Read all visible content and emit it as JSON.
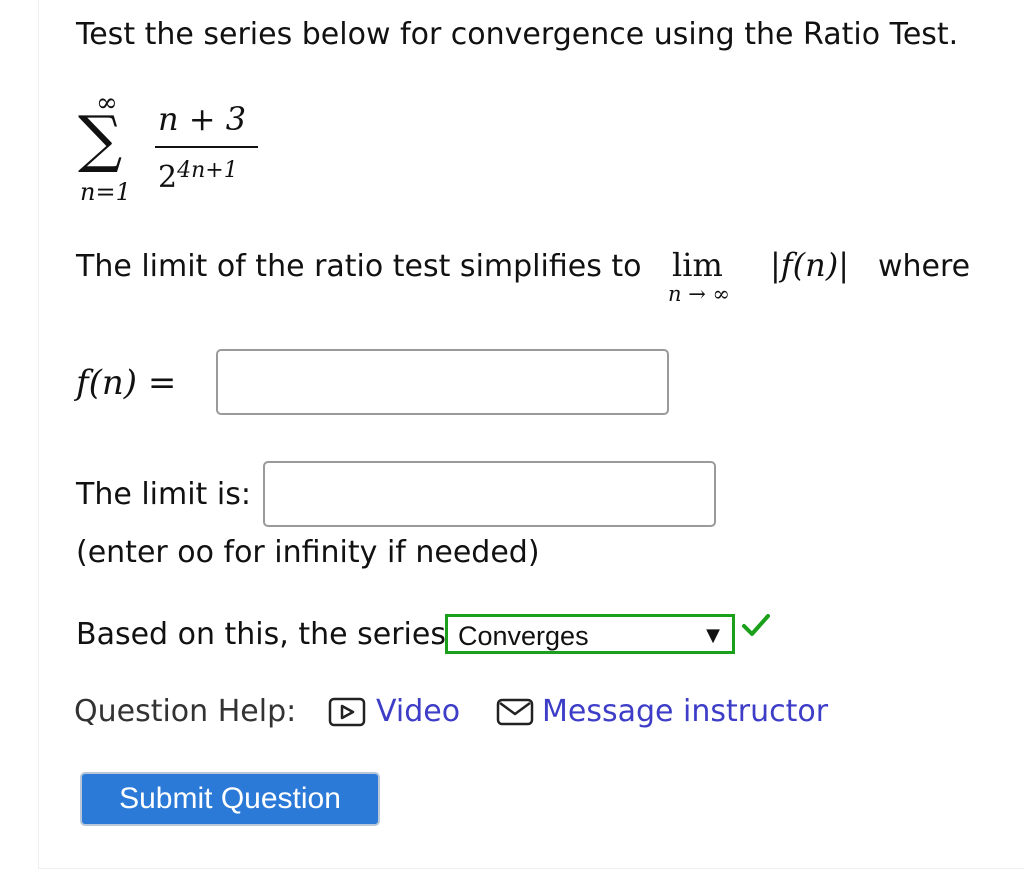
{
  "question": {
    "prompt": "Test the series below for convergence using the Ratio Test.",
    "series": {
      "sum_upper": "∞",
      "sum_lower": "n=1",
      "numerator": "n + 3",
      "denominator_base": "2",
      "denominator_exponent": "4n+1"
    },
    "ratio_text": "The limit of the ratio test simplifies to",
    "lim_word": "lim",
    "lim_subscript": "n → ∞",
    "lim_expr": "|f(n)|",
    "where_text": "where",
    "fn_label": "f(n) =",
    "fn_value": "",
    "limit_label": "The limit is:",
    "limit_value": "",
    "limit_hint": "(enter oo for infinity if needed)",
    "series_label": "Based on this, the series",
    "series_selected": "Converges",
    "series_status": "correct"
  },
  "help": {
    "label": "Question Help:",
    "video_label": "Video",
    "message_label": "Message instructor"
  },
  "submit_label": "Submit Question",
  "colors": {
    "link": "#3d3dc8",
    "submit_bg": "#2b7ad8",
    "correct": "#1aa01a"
  }
}
